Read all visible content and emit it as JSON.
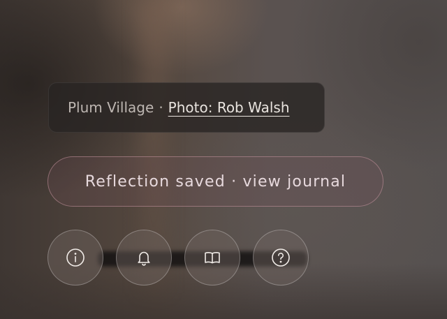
{
  "credit": {
    "location": "Plum Village",
    "separator": "·",
    "photo_link": "Photo: Rob Walsh"
  },
  "toast": {
    "text": "Reflection saved · view journal"
  },
  "actions": [
    {
      "icon": "info-icon"
    },
    {
      "icon": "bell-icon"
    },
    {
      "icon": "book-icon"
    },
    {
      "icon": "help-icon"
    }
  ],
  "colors": {
    "toast_border": "#c896a0",
    "text_primary": "#e9e4df",
    "text_secondary": "#bdb6b1"
  }
}
